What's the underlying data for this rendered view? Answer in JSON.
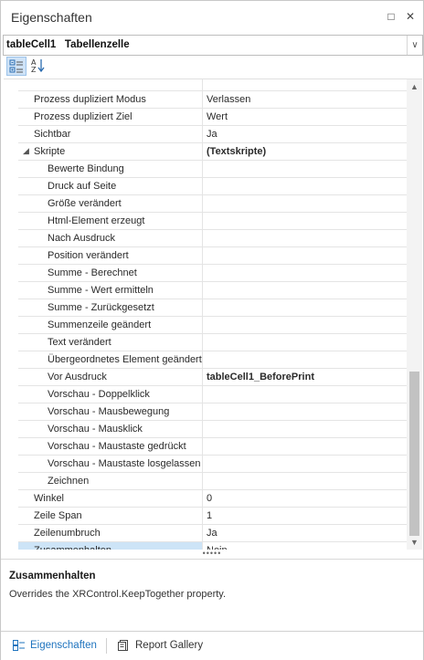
{
  "window": {
    "title": "Eigenschaften",
    "pin_glyph": "□",
    "close_glyph": "✕"
  },
  "selector": {
    "value": "tableCell1   Tabellenzelle",
    "dropdown_glyph": "∨"
  },
  "toolbar": {
    "categorized_icon": "categorized-icon",
    "alphabetical_icon": "sort-az-icon"
  },
  "properties": [
    {
      "name": "Prozess dupliziert Modus",
      "value": "Verlassen",
      "indent": 0
    },
    {
      "name": "Prozess dupliziert Ziel",
      "value": "Wert",
      "indent": 0
    },
    {
      "name": "Sichtbar",
      "value": "Ja",
      "indent": 0
    },
    {
      "name": "Skripte",
      "value": "(Textskripte)",
      "indent": 0,
      "expanded": true,
      "bold_value": true
    },
    {
      "name": "Bewerte Bindung",
      "value": "",
      "indent": 1
    },
    {
      "name": "Druck auf Seite",
      "value": "",
      "indent": 1
    },
    {
      "name": "Größe verändert",
      "value": "",
      "indent": 1
    },
    {
      "name": "Html-Element erzeugt",
      "value": "",
      "indent": 1
    },
    {
      "name": "Nach Ausdruck",
      "value": "",
      "indent": 1
    },
    {
      "name": "Position verändert",
      "value": "",
      "indent": 1
    },
    {
      "name": "Summe - Berechnet",
      "value": "",
      "indent": 1
    },
    {
      "name": "Summe - Wert ermitteln",
      "value": "",
      "indent": 1
    },
    {
      "name": "Summe - Zurückgesetzt",
      "value": "",
      "indent": 1
    },
    {
      "name": "Summenzeile geändert",
      "value": "",
      "indent": 1
    },
    {
      "name": "Text verändert",
      "value": "",
      "indent": 1
    },
    {
      "name": "Übergeordnetes Element geändert",
      "value": "",
      "indent": 1
    },
    {
      "name": "Vor Ausdruck",
      "value": "tableCell1_BeforePrint",
      "indent": 1,
      "bold_value": true
    },
    {
      "name": "Vorschau - Doppelklick",
      "value": "",
      "indent": 1
    },
    {
      "name": "Vorschau - Mausbewegung",
      "value": "",
      "indent": 1
    },
    {
      "name": "Vorschau - Mausklick",
      "value": "",
      "indent": 1
    },
    {
      "name": "Vorschau - Maustaste gedrückt",
      "value": "",
      "indent": 1
    },
    {
      "name": "Vorschau - Maustaste losgelassen",
      "value": "",
      "indent": 1
    },
    {
      "name": "Zeichnen",
      "value": "",
      "indent": 1
    },
    {
      "name": "Winkel",
      "value": "0",
      "indent": 0
    },
    {
      "name": "Zeile Span",
      "value": "1",
      "indent": 0
    },
    {
      "name": "Zeilenumbruch",
      "value": "Ja",
      "indent": 0
    },
    {
      "name": "Zusammenhalten",
      "value": "Nein",
      "indent": 0,
      "selected": true
    }
  ],
  "splitter": {
    "glyph": "•••••"
  },
  "description": {
    "title": "Zusammenhalten",
    "text": "Overrides the XRControl.KeepTogether property."
  },
  "tabs": [
    {
      "label": "Eigenschaften",
      "icon": "properties-icon",
      "active": true
    },
    {
      "label": "Report Gallery",
      "icon": "report-gallery-icon",
      "active": false
    }
  ],
  "colors": {
    "accent": "#1e73be",
    "selected_row": "#cde4f7",
    "scroll_thumb": "#c2c2c2"
  }
}
